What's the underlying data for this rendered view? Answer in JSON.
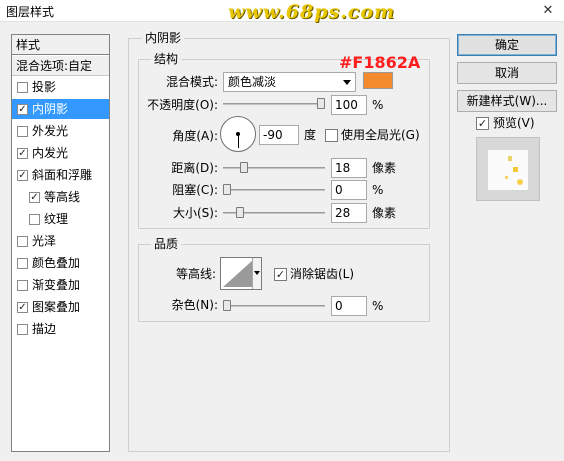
{
  "window": {
    "title": "图层样式",
    "watermark": "www.68ps.com",
    "close_glyph": "✕"
  },
  "sidebar": {
    "header": "样式",
    "blend_options": "混合选项:自定",
    "items": [
      {
        "label": "投影",
        "checked": false,
        "selected": false,
        "indent": false
      },
      {
        "label": "内阴影",
        "checked": true,
        "selected": true,
        "indent": false
      },
      {
        "label": "外发光",
        "checked": false,
        "selected": false,
        "indent": false
      },
      {
        "label": "内发光",
        "checked": true,
        "selected": false,
        "indent": false
      },
      {
        "label": "斜面和浮雕",
        "checked": true,
        "selected": false,
        "indent": false
      },
      {
        "label": "等高线",
        "checked": true,
        "selected": false,
        "indent": true
      },
      {
        "label": "纹理",
        "checked": false,
        "selected": false,
        "indent": true
      },
      {
        "label": "光泽",
        "checked": false,
        "selected": false,
        "indent": false
      },
      {
        "label": "颜色叠加",
        "checked": false,
        "selected": false,
        "indent": false
      },
      {
        "label": "渐变叠加",
        "checked": false,
        "selected": false,
        "indent": false
      },
      {
        "label": "图案叠加",
        "checked": true,
        "selected": false,
        "indent": false
      },
      {
        "label": "描边",
        "checked": false,
        "selected": false,
        "indent": false
      }
    ]
  },
  "panel": {
    "title": "内阴影",
    "structure": {
      "title": "结构",
      "blend_mode_label": "混合模式:",
      "blend_mode_value": "颜色减淡",
      "color_annotation": "#F1862A",
      "color_hex": "#f38a2d",
      "opacity_label": "不透明度(O):",
      "opacity_value": "100",
      "opacity_unit": "%",
      "opacity_fraction": 1.0,
      "angle_label": "角度(A):",
      "angle_value": "-90",
      "angle_unit": "度",
      "global_light_label": "使用全局光(G)",
      "global_light_checked": false,
      "distance_label": "距离(D):",
      "distance_value": "18",
      "distance_unit": "像素",
      "distance_fraction": 0.18,
      "choke_label": "阻塞(C):",
      "choke_value": "0",
      "choke_unit": "%",
      "choke_fraction": 0.0,
      "size_label": "大小(S):",
      "size_value": "28",
      "size_unit": "像素",
      "size_fraction": 0.14
    },
    "quality": {
      "title": "品质",
      "contour_label": "等高线:",
      "antialias_label": "消除锯齿(L)",
      "antialias_checked": true,
      "noise_label": "杂色(N):",
      "noise_value": "0",
      "noise_unit": "%",
      "noise_fraction": 0.0
    }
  },
  "buttons": {
    "ok": "确定",
    "cancel": "取消",
    "new_style": "新建样式(W)...",
    "preview_label": "预览(V)",
    "preview_checked": true
  }
}
